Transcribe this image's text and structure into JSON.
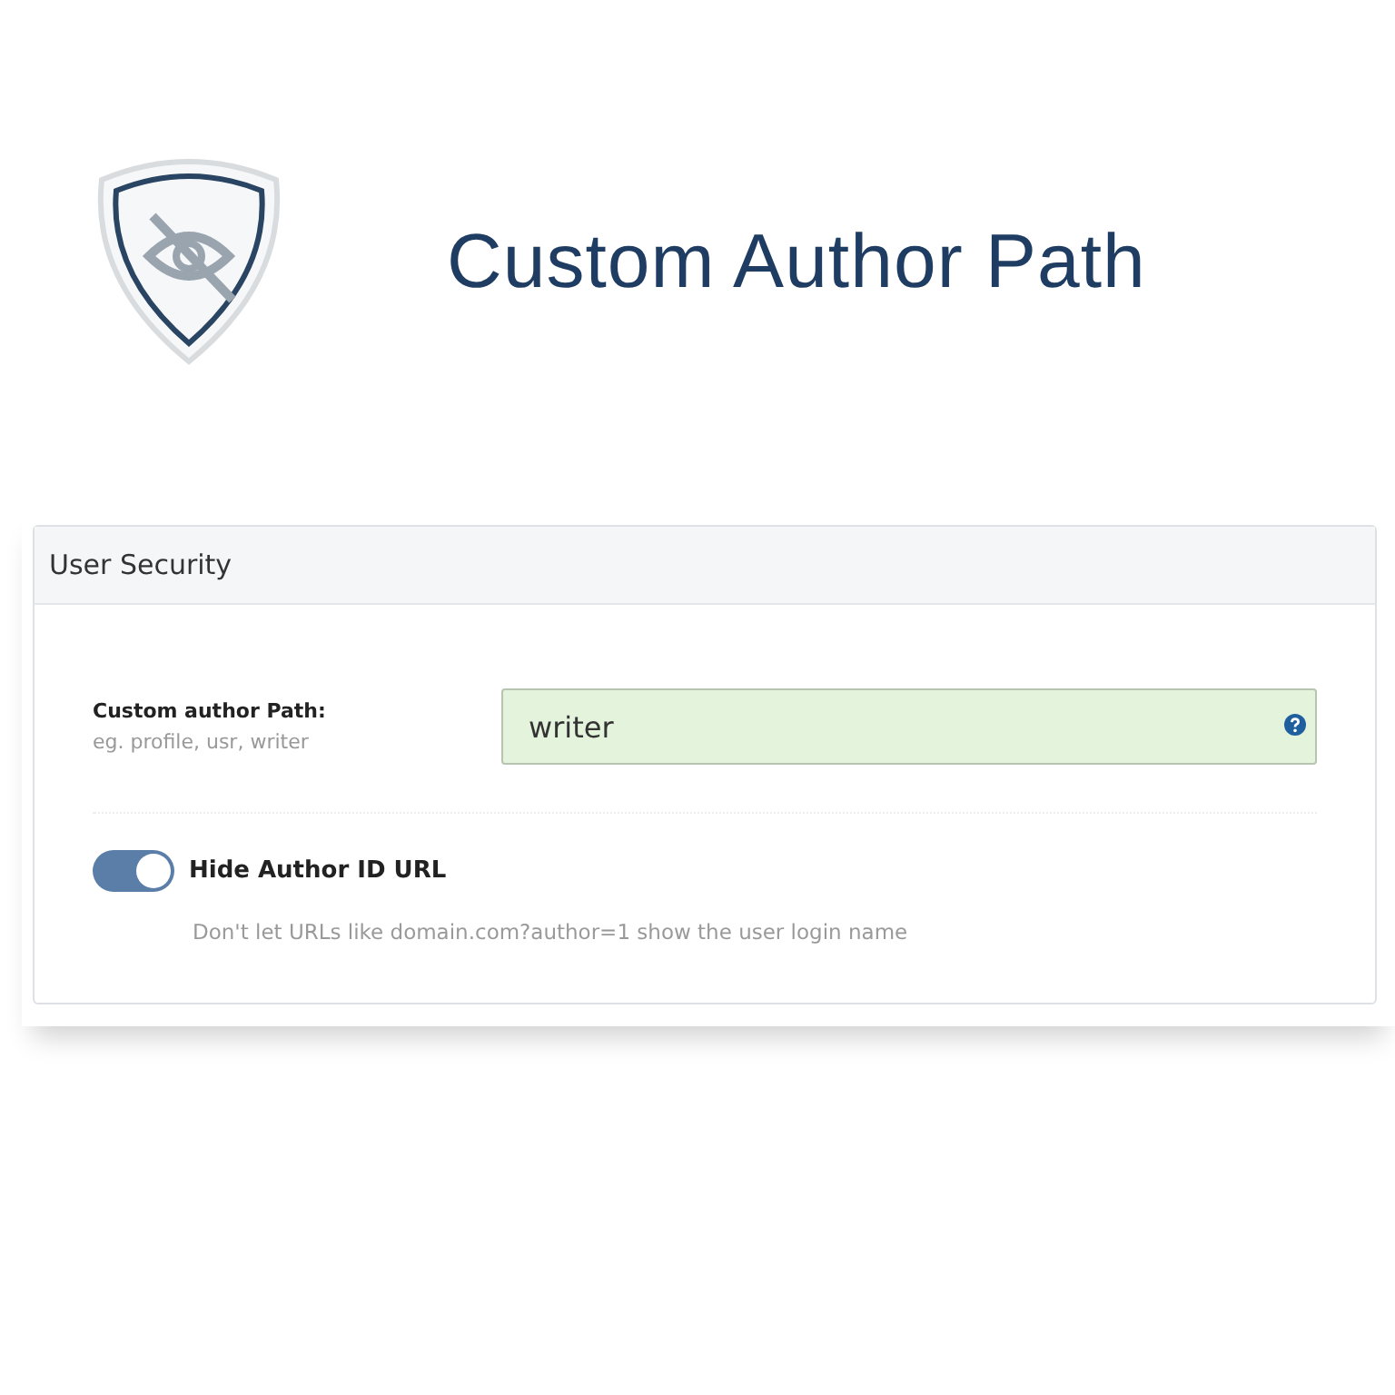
{
  "title": "Custom Author Path",
  "panel": {
    "heading": "User Security",
    "field": {
      "label": "Custom author Path:",
      "hint": "eg. profile, usr, writer",
      "value": "writer"
    },
    "toggle": {
      "label": "Hide Author ID URL",
      "on": true,
      "description": "Don't let URLs like domain.com?author=1 show the user login name"
    }
  }
}
